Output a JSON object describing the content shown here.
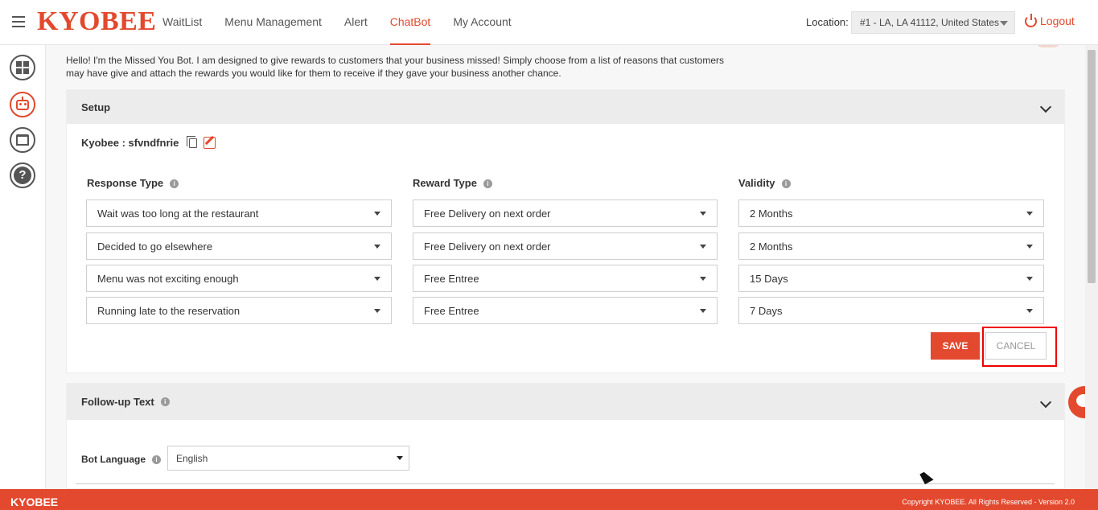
{
  "header": {
    "logo": "KYOBEE",
    "nav": [
      {
        "label": "WaitList"
      },
      {
        "label": "Menu Management"
      },
      {
        "label": "Alert"
      },
      {
        "label": "ChatBot"
      },
      {
        "label": "My Account"
      }
    ],
    "active_nav": "ChatBot",
    "location_label": "Location:",
    "location_value": "#1 - LA, LA 41112, United States",
    "logout_label": "Logout"
  },
  "sidebar": {
    "icons": [
      "dashboard-icon",
      "chatbot-icon",
      "cake-icon",
      "help-icon"
    ]
  },
  "intro_text": "Hello! I'm the Missed You Bot. I am designed to give rewards to customers that your business missed! Simply choose from a list of reasons that customers may have give and attach the rewards you would like for them to receive if they gave your business another chance.",
  "setup": {
    "title": "Setup",
    "kyobee_name": "Kyobee : sfvndfnrie",
    "columns": {
      "response": "Response Type",
      "reward": "Reward Type",
      "validity": "Validity"
    },
    "rows": [
      {
        "response": "Wait was too long at the restaurant",
        "reward": "Free Delivery on next order",
        "validity": "2 Months"
      },
      {
        "response": "Decided to go elsewhere",
        "reward": "Free Delivery on next order",
        "validity": "2 Months"
      },
      {
        "response": "Menu was not exciting enough",
        "reward": "Free Entree",
        "validity": "15 Days"
      },
      {
        "response": "Running late to the reservation",
        "reward": "Free Entree",
        "validity": "7 Days"
      }
    ],
    "save_label": "SAVE",
    "cancel_label": "CANCEL"
  },
  "followup": {
    "title": "Follow-up Text",
    "bot_language_label": "Bot Language",
    "bot_language_value": "English"
  },
  "footer": {
    "logo": "KYOBEE",
    "copyright": "Copyright KYOBEE. All Rights Reserved - Version 2.0"
  },
  "colors": {
    "brand": "#e2492e",
    "highlight": "#ee0000"
  }
}
